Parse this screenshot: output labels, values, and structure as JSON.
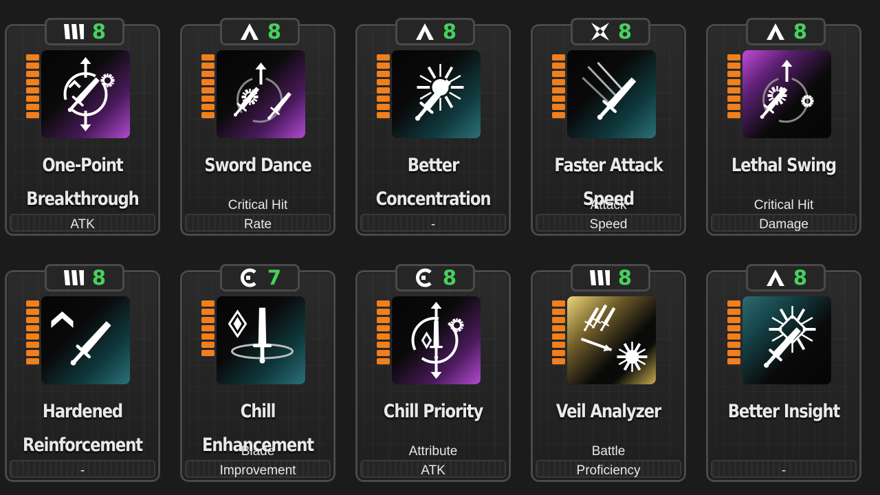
{
  "colors": {
    "level": "#46d15c",
    "pips": "#f07f1e",
    "frame": "#4a4a4a"
  },
  "cards": [
    {
      "tier_icon": "triple-bar-icon",
      "level": "8",
      "pips": 8,
      "art": "purple",
      "art_icon": "sword-circle-arrows-icon",
      "name": [
        "One-Point",
        "Breakthrough"
      ],
      "stat": [
        "",
        "ATK"
      ]
    },
    {
      "tier_icon": "chevron-icon",
      "level": "8",
      "pips": 8,
      "art": "purple",
      "art_icon": "dual-swords-up-arrow-icon",
      "name": [
        "Sword Dance"
      ],
      "stat": [
        "Critical Hit",
        "Rate"
      ]
    },
    {
      "tier_icon": "chevron-icon",
      "level": "8",
      "pips": 8,
      "art": "teal",
      "art_icon": "sword-burst-icon",
      "name": [
        "Better",
        "Concentration"
      ],
      "stat": [
        "",
        "-"
      ]
    },
    {
      "tier_icon": "four-point-star-icon",
      "level": "8",
      "pips": 8,
      "art": "teal",
      "art_icon": "swift-sword-icon",
      "name": [
        "Faster Attack Speed"
      ],
      "stat": [
        "Attack",
        "Speed"
      ]
    },
    {
      "tier_icon": "chevron-icon",
      "level": "8",
      "pips": 8,
      "art": "purple",
      "art_icon": "burst-sword-up-arrow-icon",
      "name": [
        "Lethal Swing"
      ],
      "stat": [
        "Critical Hit",
        "Damage"
      ]
    },
    {
      "tier_icon": "triple-bar-icon",
      "level": "8",
      "pips": 8,
      "art": "teal",
      "art_icon": "sword-chevron-icon",
      "name": [
        "Hardened",
        "Reinforcement"
      ],
      "stat": [
        "",
        "-"
      ]
    },
    {
      "tier_icon": "c-shape-icon",
      "level": "7",
      "pips": 7,
      "art": "teal",
      "art_icon": "blade-vortex-icon",
      "name": [
        "Chill Enhancement"
      ],
      "stat": [
        "Blade",
        "Improvement"
      ]
    },
    {
      "tier_icon": "c-shape-icon",
      "level": "8",
      "pips": 8,
      "art": "purple",
      "art_icon": "sword-diamond-arrows-icon",
      "name": [
        "Chill Priority"
      ],
      "stat": [
        "Attribute",
        "ATK"
      ]
    },
    {
      "tier_icon": "triple-bar-icon",
      "level": "8",
      "pips": 8,
      "art": "gold",
      "art_icon": "daggers-impact-icon",
      "name": [
        "Veil Analyzer"
      ],
      "stat": [
        "Battle",
        "Proficiency"
      ]
    },
    {
      "tier_icon": "chevron-icon",
      "level": "8",
      "pips": 8,
      "art": "teal",
      "art_icon": "sword-shatter-icon",
      "name": [
        "Better Insight"
      ],
      "stat": [
        "",
        "-"
      ]
    }
  ]
}
